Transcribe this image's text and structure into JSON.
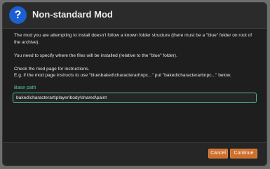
{
  "dialog": {
    "title": "Non-standard Mod",
    "icon": "question-icon",
    "paragraphs": {
      "p1": "The mod you are attempting to install doesn't follow a known folder structure (there must be a \"blue\" folder on root of the archive).",
      "p2": "You need to specify where the files will be installed (relative to the \"blue\" folder).",
      "p3": "Check the mod page for instructions.",
      "p4": "E.g. if the mod page instructs to use \"blue\\baked\\characterart\\npc...\" put \"baked\\characterart\\npc...\" below."
    },
    "base_path": {
      "label": "Base path",
      "value": "baked\\characterart\\player\\body\\shared\\paint"
    },
    "buttons": {
      "cancel": "Cancel",
      "continue": "Continue"
    }
  },
  "colors": {
    "accent": "#52c5a3",
    "button": "#cf6f2c",
    "icon_bg": "#1b5fd1"
  }
}
